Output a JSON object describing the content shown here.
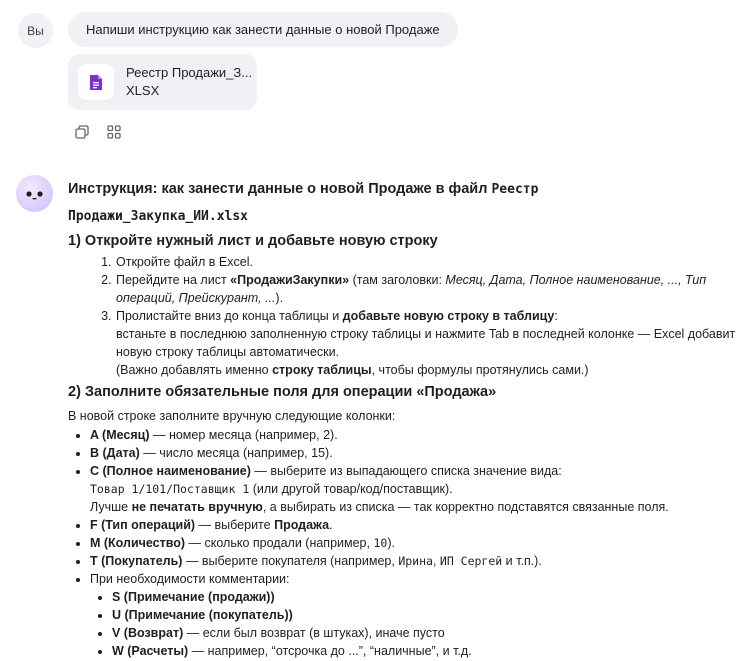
{
  "user": {
    "avatar_label": "Вы",
    "message": "Напиши инструкцию как занести данные о новой Продаже",
    "file": {
      "name": "Реестр Продажи_З...",
      "type": "XLSX"
    }
  },
  "message_actions": [
    "copy-icon",
    "grid-icon"
  ],
  "answer": {
    "title": {
      "part1": "Инструкция: как занести данные о новой ",
      "bold": "Продаже",
      "part2": " в файл ",
      "code1": "Реестр",
      "code2": "Продажи_Закупка_ИИ.xlsx"
    },
    "section1": {
      "heading": "1) Откройте нужный лист и добавьте новую строку",
      "steps": [
        {
          "text": "Откройте файл в Excel."
        },
        {
          "pre": "Перейдите на лист ",
          "bold": "«ПродажиЗакупки»",
          "mid": " (там заголовки: ",
          "italic": "Месяц, Дата, Полное наименование, ..., Тип операций, Прейскурант, ...",
          "post": ")."
        },
        {
          "pre": "Пролистайте вниз до конца таблицы и ",
          "bold": "добавьте новую строку в таблицу",
          "post": ":",
          "line2": "встаньте в последнюю заполненную строку таблицы и нажмите Tab в последней колонке — Excel добавит новую строку таблицы автоматически.",
          "line3_pre": "(Важно добавлять именно ",
          "line3_bold": "строку таблицы",
          "line3_post": ", чтобы формулы протянулись сами.)"
        }
      ]
    },
    "section2": {
      "heading": "2) Заполните обязательные поля для операции «Продажа»",
      "intro": "В новой строке заполните вручную следующие колонки:",
      "items": {
        "a": {
          "bold": "A (Месяц)",
          "text": " — номер месяца (например, 2)."
        },
        "b": {
          "bold": "B (Дата)",
          "text": " — число месяца (например, 15)."
        },
        "c": {
          "bold": "C (Полное наименование)",
          "text": " — выберите из выпадающего списка значение вида:",
          "code": "Товар 1/101/Поставщик 1",
          "code_post": " (или другой товар/код/поставщик).",
          "line3_pre": "Лучше ",
          "line3_bold": "не печатать вручную",
          "line3_post": ", а выбирать из списка — так корректно подставятся связанные поля."
        },
        "f": {
          "bold": "F (Тип операций)",
          "text": " — выберите ",
          "bold2": "Продажа",
          "post": "."
        },
        "m": {
          "bold": "M (Количество)",
          "text": " — сколько продали (например, ",
          "code": "10",
          "post": ")."
        },
        "t": {
          "bold": "T (Покупатель)",
          "text": " — выберите покупателя (например, ",
          "code1": "Ирина",
          "sep": ", ",
          "code2": "ИП Сергей",
          "post": " и т.п.)."
        },
        "comments": {
          "text": "При необходимости комментарии:",
          "sub": [
            {
              "bold": "S (Примечание (продажи))",
              "text": ""
            },
            {
              "bold": "U (Примечание (покупатель))",
              "text": ""
            },
            {
              "bold": "V (Возврат)",
              "text": " — если был возврат (в штуках), иначе пусто"
            },
            {
              "bold": "W (Расчеты)",
              "text": " — например, “отсрочка до ...”, “наличные”, и т.д."
            }
          ]
        }
      }
    }
  }
}
